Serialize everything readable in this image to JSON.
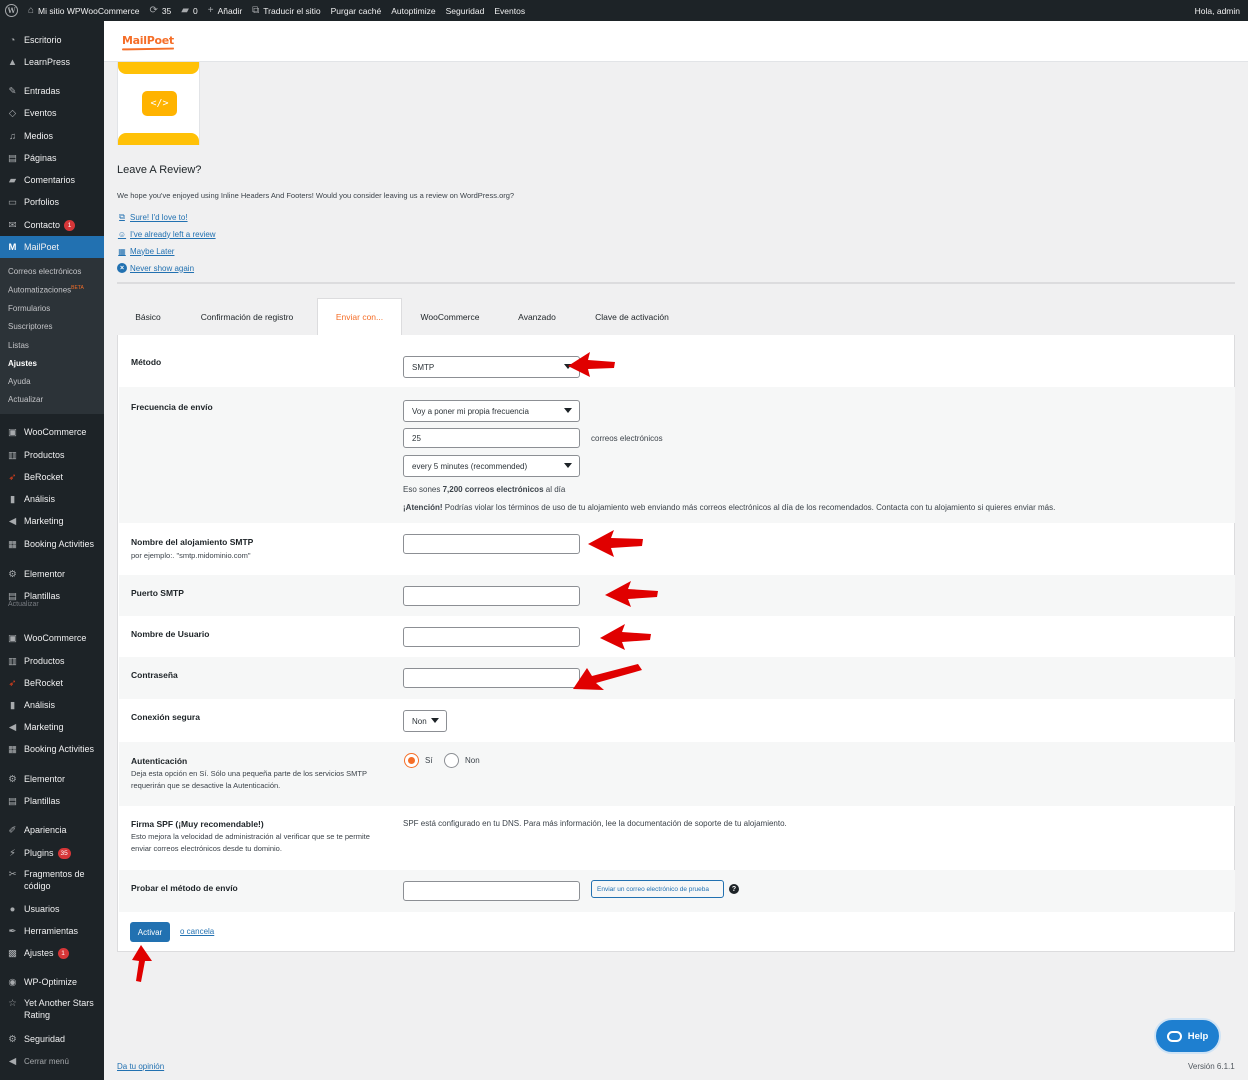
{
  "admin_bar": {
    "site_name": "Mi sitio WPWooCommerce",
    "updates_count": "35",
    "comments_count": "0",
    "add_new": "Añadir",
    "translate": "Traducir el sitio",
    "purge_cache": "Purgar caché",
    "autoptimize": "Autoptimize",
    "security": "Seguridad",
    "events": "Eventos",
    "greeting": "Hola, admin"
  },
  "sidebar": {
    "items": {
      "escritorio": "Escritorio",
      "learnpress": "LearnPress",
      "entradas": "Entradas",
      "eventos": "Eventos",
      "medios": "Medios",
      "paginas": "Páginas",
      "comentarios": "Comentarios",
      "porfolios": "Porfolios",
      "contacto": "Contacto",
      "contacto_badge": "1",
      "mailpoet": "MailPoet",
      "woocommerce": "WooCommerce",
      "productos": "Productos",
      "berocket": "BeRocket",
      "analisis": "Análisis",
      "marketing": "Marketing",
      "booking": "Booking Activities",
      "elementor": "Elementor",
      "plantillas": "Plantillas",
      "actualizar_ghost": "Actualizar",
      "apariencia": "Apariencia",
      "plugins": "Plugins",
      "plugins_badge": "35",
      "fragmentos": "Fragmentos de código",
      "usuarios": "Usuarios",
      "herramientas": "Herramientas",
      "ajustes": "Ajustes",
      "ajustes_badge": "1",
      "wpoptimize": "WP-Optimize",
      "yasr": "Yet Another Stars Rating",
      "seguridad": "Seguridad",
      "cerrar": "Cerrar menú"
    },
    "submenu": {
      "correos": "Correos electrónicos",
      "automatizaciones": "Automatizaciones",
      "beta": "BETA",
      "formularios": "Formularios",
      "suscriptores": "Suscriptores",
      "listas": "Listas",
      "ajustes": "Ajustes",
      "ayuda": "Ayuda",
      "actualizar": "Actualizar"
    }
  },
  "header": {
    "logo": "MailPoet"
  },
  "notice": {
    "code_glyph": "</>",
    "title": "Leave A Review?",
    "text": "We hope you've enjoyed using Inline Headers And Footers! Would you consider leaving us a review on WordPress.org?",
    "links": {
      "sure": "Sure! I'd love to!",
      "already": "I've already left a review",
      "later": "Maybe Later",
      "never": "Never show again"
    }
  },
  "tabs": {
    "basico": "Básico",
    "confirmacion": "Confirmación de registro",
    "enviar": "Enviar con...",
    "woocommerce": "WooCommerce",
    "avanzado": "Avanzado",
    "clave": "Clave de activación"
  },
  "settings": {
    "metodo": {
      "label": "Método",
      "value": "SMTP"
    },
    "frecuencia": {
      "label": "Frecuencia de envío",
      "mode": "Voy a poner mi propia frecuencia",
      "count": "25",
      "count_unit": "correos electrónicos",
      "interval": "every 5 minutes (recommended)",
      "summary_prefix": "Eso sones ",
      "summary_strong": "7,200 correos electrónicos",
      "summary_suffix": " al día",
      "warning_strong": "¡Atención!",
      "warning_text": " Podrías violar los términos de uso de tu alojamiento web enviando más correos electrónicos al día de los recomendados. Contacta con tu alojamiento si quieres enviar más."
    },
    "host": {
      "label": "Nombre del alojamiento SMTP",
      "desc": "por ejemplo:. \"smtp.midominio.com\"",
      "value": ""
    },
    "puerto": {
      "label": "Puerto SMTP",
      "value": ""
    },
    "usuario": {
      "label": "Nombre de Usuario",
      "value": ""
    },
    "contrasena": {
      "label": "Contraseña",
      "value": ""
    },
    "conexion": {
      "label": "Conexión segura",
      "value": "Non"
    },
    "autenticacion": {
      "label": "Autenticación",
      "desc": "Deja esta opción en Sí. Sólo una pequeña parte de los servicios SMTP requerirán que se desactive la Autenticación.",
      "opt_yes": "Sí",
      "opt_no": "Non",
      "selected": "Sí"
    },
    "spf": {
      "label": "Firma SPF (¡Muy recomendable!)",
      "desc": "Esto mejora la velocidad de administración al verificar que se te permite enviar correos electrónicos desde tu dominio.",
      "text": "SPF está configurado en tu DNS. Para más información, lee la documentación de soporte de tu alojamiento."
    },
    "probar": {
      "label": "Probar el método de envío",
      "value": "",
      "button": "Enviar un correo electrónico de prueba",
      "help": "?"
    },
    "activar": "Activar",
    "cancelar": "o cancela"
  },
  "help_button": "Help",
  "footer": {
    "opinion": "Da tu opinión",
    "version": "Versión 6.1.1"
  },
  "colors": {
    "accent": "#f56e28",
    "wp_blue": "#2271b1",
    "admin_dark": "#1d2327",
    "arrow": "#e00000"
  }
}
